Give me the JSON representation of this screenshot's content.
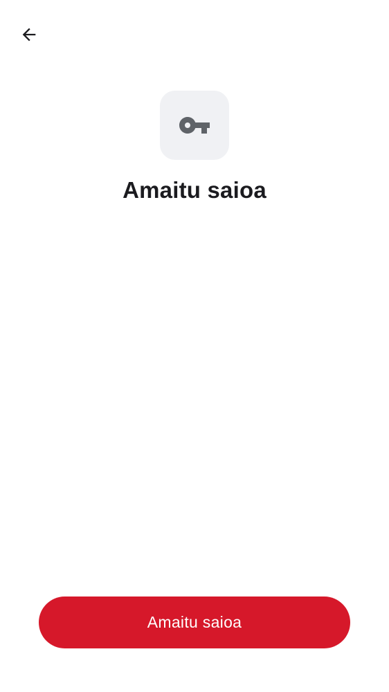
{
  "header": {
    "back_icon": "arrow-left-icon"
  },
  "hero": {
    "icon": "key-icon",
    "icon_color": "#5f6368",
    "tile_color": "#f0f1f4",
    "title": "Amaitu saioa"
  },
  "footer": {
    "primary_button_label": "Amaitu saioa",
    "primary_button_color": "#d6182a"
  }
}
